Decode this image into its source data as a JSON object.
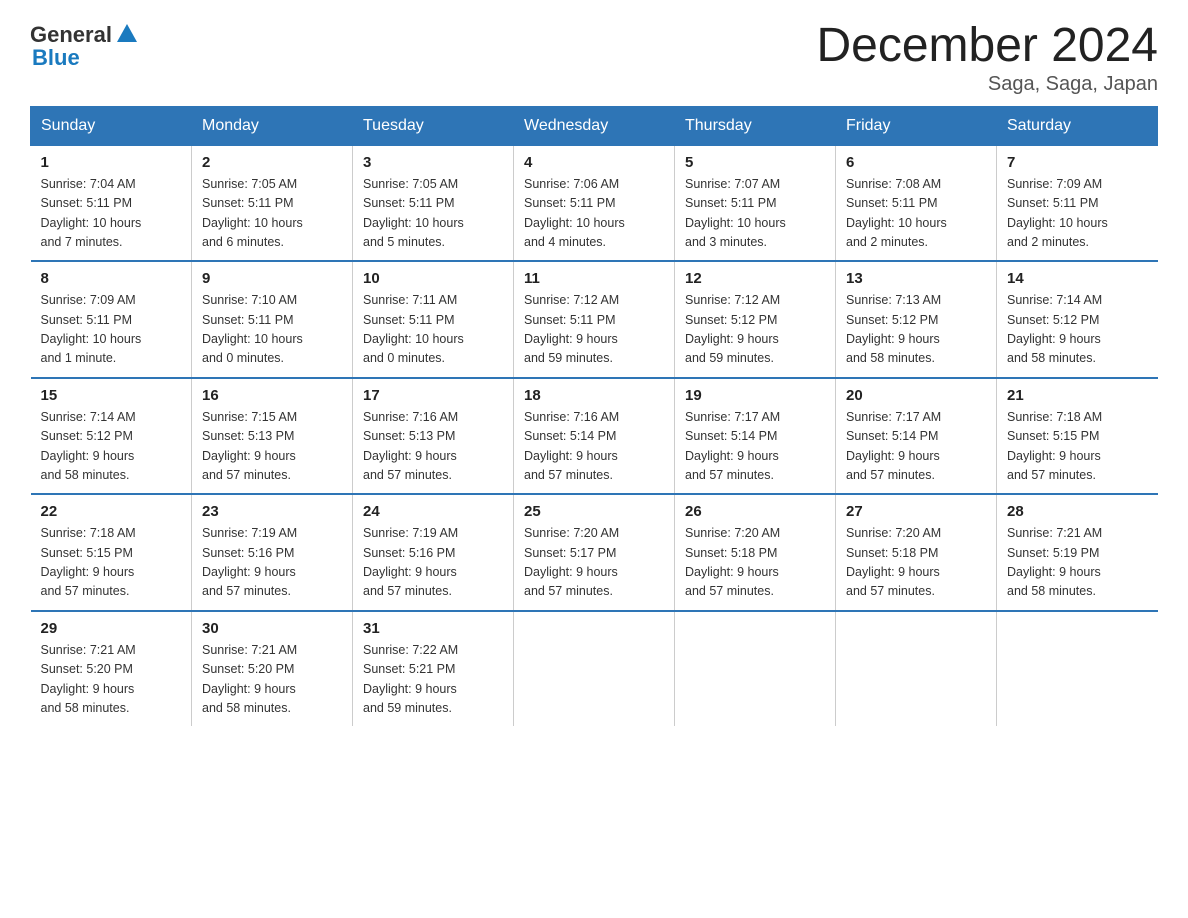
{
  "header": {
    "logo_general": "General",
    "logo_blue": "Blue",
    "title": "December 2024",
    "subtitle": "Saga, Saga, Japan"
  },
  "days_of_week": [
    "Sunday",
    "Monday",
    "Tuesday",
    "Wednesday",
    "Thursday",
    "Friday",
    "Saturday"
  ],
  "weeks": [
    [
      {
        "day": "1",
        "info": "Sunrise: 7:04 AM\nSunset: 5:11 PM\nDaylight: 10 hours\nand 7 minutes."
      },
      {
        "day": "2",
        "info": "Sunrise: 7:05 AM\nSunset: 5:11 PM\nDaylight: 10 hours\nand 6 minutes."
      },
      {
        "day": "3",
        "info": "Sunrise: 7:05 AM\nSunset: 5:11 PM\nDaylight: 10 hours\nand 5 minutes."
      },
      {
        "day": "4",
        "info": "Sunrise: 7:06 AM\nSunset: 5:11 PM\nDaylight: 10 hours\nand 4 minutes."
      },
      {
        "day": "5",
        "info": "Sunrise: 7:07 AM\nSunset: 5:11 PM\nDaylight: 10 hours\nand 3 minutes."
      },
      {
        "day": "6",
        "info": "Sunrise: 7:08 AM\nSunset: 5:11 PM\nDaylight: 10 hours\nand 2 minutes."
      },
      {
        "day": "7",
        "info": "Sunrise: 7:09 AM\nSunset: 5:11 PM\nDaylight: 10 hours\nand 2 minutes."
      }
    ],
    [
      {
        "day": "8",
        "info": "Sunrise: 7:09 AM\nSunset: 5:11 PM\nDaylight: 10 hours\nand 1 minute."
      },
      {
        "day": "9",
        "info": "Sunrise: 7:10 AM\nSunset: 5:11 PM\nDaylight: 10 hours\nand 0 minutes."
      },
      {
        "day": "10",
        "info": "Sunrise: 7:11 AM\nSunset: 5:11 PM\nDaylight: 10 hours\nand 0 minutes."
      },
      {
        "day": "11",
        "info": "Sunrise: 7:12 AM\nSunset: 5:11 PM\nDaylight: 9 hours\nand 59 minutes."
      },
      {
        "day": "12",
        "info": "Sunrise: 7:12 AM\nSunset: 5:12 PM\nDaylight: 9 hours\nand 59 minutes."
      },
      {
        "day": "13",
        "info": "Sunrise: 7:13 AM\nSunset: 5:12 PM\nDaylight: 9 hours\nand 58 minutes."
      },
      {
        "day": "14",
        "info": "Sunrise: 7:14 AM\nSunset: 5:12 PM\nDaylight: 9 hours\nand 58 minutes."
      }
    ],
    [
      {
        "day": "15",
        "info": "Sunrise: 7:14 AM\nSunset: 5:12 PM\nDaylight: 9 hours\nand 58 minutes."
      },
      {
        "day": "16",
        "info": "Sunrise: 7:15 AM\nSunset: 5:13 PM\nDaylight: 9 hours\nand 57 minutes."
      },
      {
        "day": "17",
        "info": "Sunrise: 7:16 AM\nSunset: 5:13 PM\nDaylight: 9 hours\nand 57 minutes."
      },
      {
        "day": "18",
        "info": "Sunrise: 7:16 AM\nSunset: 5:14 PM\nDaylight: 9 hours\nand 57 minutes."
      },
      {
        "day": "19",
        "info": "Sunrise: 7:17 AM\nSunset: 5:14 PM\nDaylight: 9 hours\nand 57 minutes."
      },
      {
        "day": "20",
        "info": "Sunrise: 7:17 AM\nSunset: 5:14 PM\nDaylight: 9 hours\nand 57 minutes."
      },
      {
        "day": "21",
        "info": "Sunrise: 7:18 AM\nSunset: 5:15 PM\nDaylight: 9 hours\nand 57 minutes."
      }
    ],
    [
      {
        "day": "22",
        "info": "Sunrise: 7:18 AM\nSunset: 5:15 PM\nDaylight: 9 hours\nand 57 minutes."
      },
      {
        "day": "23",
        "info": "Sunrise: 7:19 AM\nSunset: 5:16 PM\nDaylight: 9 hours\nand 57 minutes."
      },
      {
        "day": "24",
        "info": "Sunrise: 7:19 AM\nSunset: 5:16 PM\nDaylight: 9 hours\nand 57 minutes."
      },
      {
        "day": "25",
        "info": "Sunrise: 7:20 AM\nSunset: 5:17 PM\nDaylight: 9 hours\nand 57 minutes."
      },
      {
        "day": "26",
        "info": "Sunrise: 7:20 AM\nSunset: 5:18 PM\nDaylight: 9 hours\nand 57 minutes."
      },
      {
        "day": "27",
        "info": "Sunrise: 7:20 AM\nSunset: 5:18 PM\nDaylight: 9 hours\nand 57 minutes."
      },
      {
        "day": "28",
        "info": "Sunrise: 7:21 AM\nSunset: 5:19 PM\nDaylight: 9 hours\nand 58 minutes."
      }
    ],
    [
      {
        "day": "29",
        "info": "Sunrise: 7:21 AM\nSunset: 5:20 PM\nDaylight: 9 hours\nand 58 minutes."
      },
      {
        "day": "30",
        "info": "Sunrise: 7:21 AM\nSunset: 5:20 PM\nDaylight: 9 hours\nand 58 minutes."
      },
      {
        "day": "31",
        "info": "Sunrise: 7:22 AM\nSunset: 5:21 PM\nDaylight: 9 hours\nand 59 minutes."
      },
      {
        "day": "",
        "info": ""
      },
      {
        "day": "",
        "info": ""
      },
      {
        "day": "",
        "info": ""
      },
      {
        "day": "",
        "info": ""
      }
    ]
  ]
}
